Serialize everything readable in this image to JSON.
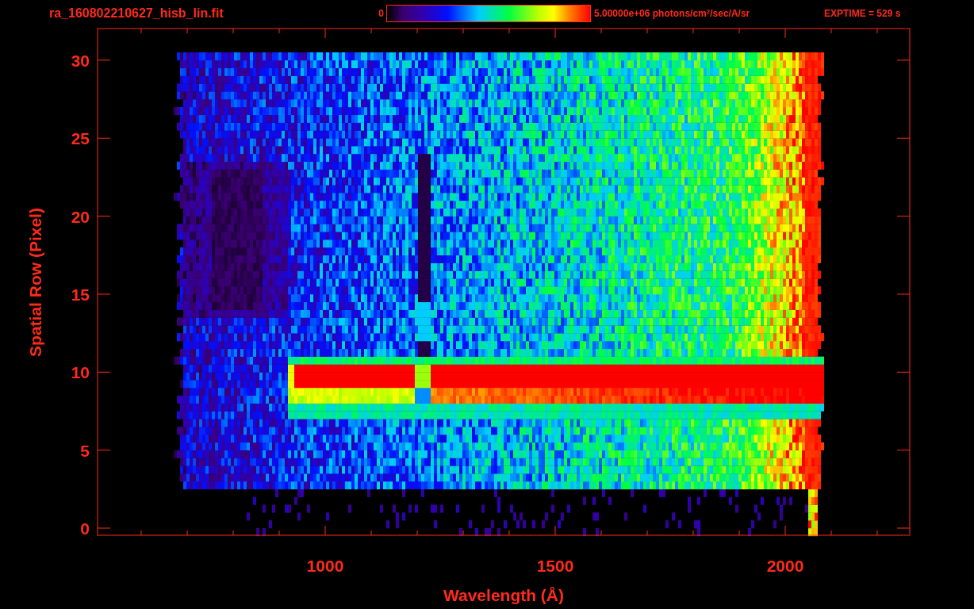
{
  "header": {
    "filename": "ra_160802210627_hisb_lin.fit",
    "colorbar": {
      "min_label": "0",
      "max_label": "5.00000e+06 photons/cm$^{2}$/sec/A/sr"
    },
    "exptime": "EXPTIME = 529 s"
  },
  "plot": {
    "ylabel": "Spatial Row (Pixel)",
    "xlabel": "Wavelength (Å)",
    "yticks": [
      "30",
      "25",
      "20",
      "15",
      "10",
      "5",
      "0"
    ],
    "xticks": [
      "1000",
      "1500",
      "2000"
    ]
  }
}
